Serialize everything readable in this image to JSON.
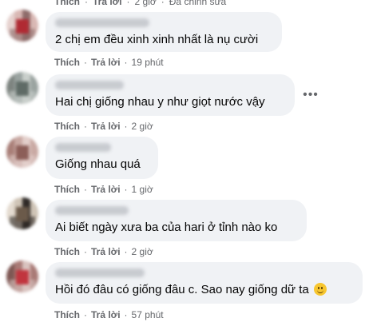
{
  "top": {
    "like": "Thích",
    "reply": "Trả lời",
    "time": "2 giờ",
    "edited": "Đã chỉnh sửa"
  },
  "comments": [
    {
      "text": "2 chị em đều xinh xinh nhất là nụ cười",
      "like": "Thích",
      "reply": "Trả lời",
      "time": "19 phút",
      "avatar_colors": [
        "#d9b8b4",
        "#b02a33",
        "#8e6c6a",
        "#e6d2cf"
      ]
    },
    {
      "text": "Hai chị giống nhau y như giọt nước vậy",
      "like": "Thích",
      "reply": "Trả lời",
      "time": "2 giờ",
      "more_label": "•••",
      "avatar_colors": [
        "#9aa3a0",
        "#5f6b66",
        "#c9cfcb",
        "#7d8480"
      ]
    },
    {
      "text": "Giống nhau quá",
      "like": "Thích",
      "reply": "Trả lời",
      "time": "1 giờ",
      "avatar_colors": [
        "#c9a9a3",
        "#8c5e58",
        "#e3cfcb",
        "#a97f78"
      ]
    },
    {
      "text": "Ai biết ngày xưa ba của hari ở tỉnh nào ko",
      "like": "Thích",
      "reply": "Trả lời",
      "time": "2 giờ",
      "avatar_colors": [
        "#cfc4b6",
        "#6b5a4a",
        "#2f2a27",
        "#e4dbd0"
      ]
    },
    {
      "text": "Hồi đó đâu có giống đâu c. Sao nay giống dữ ta",
      "like": "Thích",
      "reply": "Trả lời",
      "time": "57 phút",
      "avatar_colors": [
        "#a97a76",
        "#c1353e",
        "#d9c3bf",
        "#7e5753"
      ]
    }
  ],
  "separator": "·"
}
